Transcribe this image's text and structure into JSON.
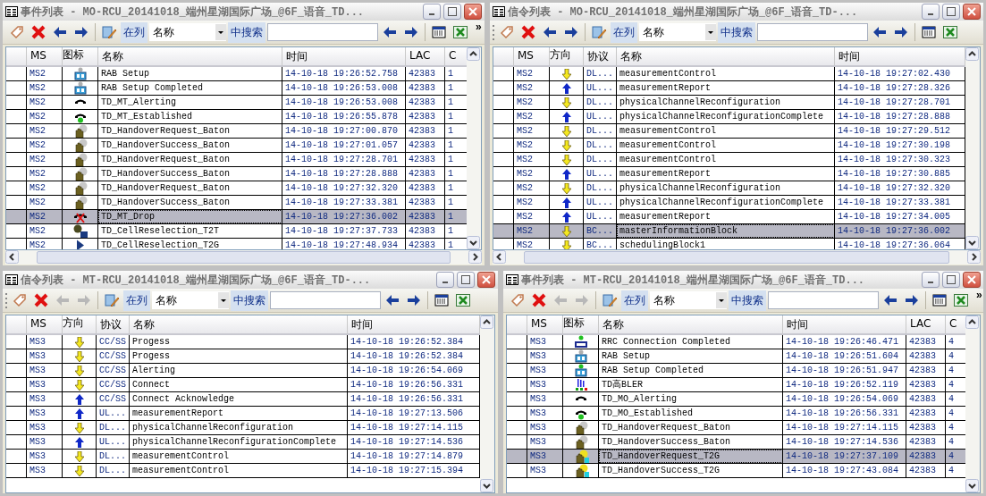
{
  "windows": [
    {
      "title": "事件列表 - MO-RCU_20141018_端州星湖国际广场_@6F_语音_TD...",
      "nav_enabled": true,
      "toolbar": {
        "in_column": "在列",
        "column": "名称",
        "search_label": "中搜索",
        "overflow": "»"
      },
      "columns": [
        {
          "kind": "ms",
          "label": "MS"
        },
        {
          "kind": "icon",
          "label": "图标"
        },
        {
          "kind": "name",
          "label": "名称"
        },
        {
          "kind": "time",
          "label": "时间"
        },
        {
          "kind": "lac",
          "label": "LAC"
        },
        {
          "kind": "cut",
          "label": "C"
        }
      ],
      "rows": [
        {
          "ms": "MS2",
          "kind": "rb-gray",
          "name": "RAB Setup",
          "time": "14-10-18 19:26:52.758",
          "lac": "42383",
          "cut": "1",
          "selected": false
        },
        {
          "ms": "MS2",
          "kind": "rb-gray",
          "name": "RAB Setup Completed",
          "time": "14-10-18 19:26:53.008",
          "lac": "42383",
          "cut": "1",
          "selected": false
        },
        {
          "ms": "MS2",
          "kind": "phone",
          "name": "TD_MT_Alerting",
          "time": "14-10-18 19:26:53.008",
          "lac": "42383",
          "cut": "1",
          "selected": false
        },
        {
          "ms": "MS2",
          "kind": "phone-dot",
          "name": "TD_MT_Established",
          "time": "14-10-18 19:26:55.878",
          "lac": "42383",
          "cut": "1",
          "selected": false
        },
        {
          "ms": "MS2",
          "kind": "hand",
          "name": "TD_HandoverRequest_Baton",
          "time": "14-10-18 19:27:00.870",
          "lac": "42383",
          "cut": "1",
          "selected": false
        },
        {
          "ms": "MS2",
          "kind": "hand",
          "name": "TD_HandoverSuccess_Baton",
          "time": "14-10-18 19:27:01.057",
          "lac": "42383",
          "cut": "1",
          "selected": false
        },
        {
          "ms": "MS2",
          "kind": "hand",
          "name": "TD_HandoverRequest_Baton",
          "time": "14-10-18 19:27:28.701",
          "lac": "42383",
          "cut": "1",
          "selected": false
        },
        {
          "ms": "MS2",
          "kind": "hand",
          "name": "TD_HandoverSuccess_Baton",
          "time": "14-10-18 19:27:28.888",
          "lac": "42383",
          "cut": "1",
          "selected": false
        },
        {
          "ms": "MS2",
          "kind": "hand",
          "name": "TD_HandoverRequest_Baton",
          "time": "14-10-18 19:27:32.320",
          "lac": "42383",
          "cut": "1",
          "selected": false
        },
        {
          "ms": "MS2",
          "kind": "hand",
          "name": "TD_HandoverSuccess_Baton",
          "time": "14-10-18 19:27:33.381",
          "lac": "42383",
          "cut": "1",
          "selected": false
        },
        {
          "ms": "MS2",
          "kind": "drop",
          "name": "TD_MT_Drop",
          "time": "14-10-18 19:27:36.002",
          "lac": "42383",
          "cut": "1",
          "selected": true
        },
        {
          "ms": "MS2",
          "kind": "cells",
          "name": "TD_CellReselection_T2T",
          "time": "14-10-18 19:27:37.733",
          "lac": "42383",
          "cut": "1",
          "selected": false
        },
        {
          "ms": "MS2",
          "kind": "triangle",
          "name": "TD_CellReselection_T2G",
          "time": "14-10-18 19:27:48.934",
          "lac": "42383",
          "cut": "1",
          "selected": false
        }
      ]
    },
    {
      "title": "信令列表 - MO-RCU_20141018_端州星湖国际广场_@6F_语音_TD-...",
      "nav_enabled": true,
      "toolbar": {
        "in_column": "在列",
        "column": "名称",
        "search_label": "中搜索"
      },
      "columns": [
        {
          "kind": "ms",
          "label": "MS"
        },
        {
          "kind": "dir",
          "label": "方向"
        },
        {
          "kind": "proto",
          "label": "协议"
        },
        {
          "kind": "name",
          "label": "名称"
        },
        {
          "kind": "time",
          "label": "时间"
        }
      ],
      "rows": [
        {
          "ms": "MS2",
          "kind": "down",
          "proto": "DL...",
          "name": "measurementControl",
          "time": "14-10-18 19:27:02.430",
          "selected": false
        },
        {
          "ms": "MS2",
          "kind": "up",
          "proto": "UL...",
          "name": "measurementReport",
          "time": "14-10-18 19:27:28.326",
          "selected": false
        },
        {
          "ms": "MS2",
          "kind": "down",
          "proto": "DL...",
          "name": "physicalChannelReconfiguration",
          "time": "14-10-18 19:27:28.701",
          "selected": false
        },
        {
          "ms": "MS2",
          "kind": "up",
          "proto": "UL...",
          "name": "physicalChannelReconfigurationComplete",
          "time": "14-10-18 19:27:28.888",
          "selected": false
        },
        {
          "ms": "MS2",
          "kind": "down",
          "proto": "DL...",
          "name": "measurementControl",
          "time": "14-10-18 19:27:29.512",
          "selected": false
        },
        {
          "ms": "MS2",
          "kind": "down",
          "proto": "DL...",
          "name": "measurementControl",
          "time": "14-10-18 19:27:30.198",
          "selected": false
        },
        {
          "ms": "MS2",
          "kind": "down",
          "proto": "DL...",
          "name": "measurementControl",
          "time": "14-10-18 19:27:30.323",
          "selected": false
        },
        {
          "ms": "MS2",
          "kind": "up",
          "proto": "UL...",
          "name": "measurementReport",
          "time": "14-10-18 19:27:30.885",
          "selected": false
        },
        {
          "ms": "MS2",
          "kind": "down",
          "proto": "DL...",
          "name": "physicalChannelReconfiguration",
          "time": "14-10-18 19:27:32.320",
          "selected": false
        },
        {
          "ms": "MS2",
          "kind": "up",
          "proto": "UL...",
          "name": "physicalChannelReconfigurationComplete",
          "time": "14-10-18 19:27:33.381",
          "selected": false
        },
        {
          "ms": "MS2",
          "kind": "up",
          "proto": "UL...",
          "name": "measurementReport",
          "time": "14-10-18 19:27:34.005",
          "selected": false
        },
        {
          "ms": "MS2",
          "kind": "down",
          "proto": "BC...",
          "name": "masterInformationBlock",
          "time": "14-10-18 19:27:36.002",
          "selected": true
        },
        {
          "ms": "MS2",
          "kind": "down",
          "proto": "BC...",
          "name": "schedulingBlock1",
          "time": "14-10-18 19:27:36.064",
          "selected": false
        }
      ]
    },
    {
      "title": "信令列表 - MT-RCU_20141018_端州星湖国际广场_@6F_语音_TD-...",
      "nav_enabled": false,
      "toolbar": {
        "in_column": "在列",
        "column": "名称",
        "search_label": "中搜索"
      },
      "columns": [
        {
          "kind": "ms",
          "label": "MS"
        },
        {
          "kind": "dir",
          "label": "方向"
        },
        {
          "kind": "proto",
          "label": "协议"
        },
        {
          "kind": "name",
          "label": "名称"
        },
        {
          "kind": "time",
          "label": "时间"
        }
      ],
      "rows": [
        {
          "ms": "MS3",
          "kind": "down",
          "proto": "CC/SS",
          "name": "Progess",
          "time": "14-10-18 19:26:52.384",
          "selected": false
        },
        {
          "ms": "MS3",
          "kind": "down",
          "proto": "CC/SS",
          "name": "Progess",
          "time": "14-10-18 19:26:52.384",
          "selected": false
        },
        {
          "ms": "MS3",
          "kind": "down",
          "proto": "CC/SS",
          "name": "Alerting",
          "time": "14-10-18 19:26:54.069",
          "selected": false
        },
        {
          "ms": "MS3",
          "kind": "down",
          "proto": "CC/SS",
          "name": "Connect",
          "time": "14-10-18 19:26:56.331",
          "selected": false
        },
        {
          "ms": "MS3",
          "kind": "up",
          "proto": "CC/SS",
          "name": "Connect Acknowledge",
          "time": "14-10-18 19:26:56.331",
          "selected": false
        },
        {
          "ms": "MS3",
          "kind": "up",
          "proto": "UL...",
          "name": "measurementReport",
          "time": "14-10-18 19:27:13.506",
          "selected": false
        },
        {
          "ms": "MS3",
          "kind": "down",
          "proto": "DL...",
          "name": "physicalChannelReconfiguration",
          "time": "14-10-18 19:27:14.115",
          "selected": false
        },
        {
          "ms": "MS3",
          "kind": "up",
          "proto": "UL...",
          "name": "physicalChannelReconfigurationComplete",
          "time": "14-10-18 19:27:14.536",
          "selected": false
        },
        {
          "ms": "MS3",
          "kind": "down",
          "proto": "DL...",
          "name": "measurementControl",
          "time": "14-10-18 19:27:14.879",
          "selected": false
        },
        {
          "ms": "MS3",
          "kind": "down",
          "proto": "DL...",
          "name": "measurementControl",
          "time": "14-10-18 19:27:15.394",
          "selected": false
        }
      ]
    },
    {
      "title": "事件列表 - MT-RCU_20141018_端州星湖国际广场_@6F_语音_TD...",
      "nav_enabled": false,
      "toolbar": {
        "in_column": "在列",
        "column": "名称",
        "search_label": "中搜索",
        "overflow": "»"
      },
      "columns": [
        {
          "kind": "ms",
          "label": "MS"
        },
        {
          "kind": "icon",
          "label": "图标"
        },
        {
          "kind": "name",
          "label": "名称"
        },
        {
          "kind": "time",
          "label": "时间"
        },
        {
          "kind": "lac",
          "label": "LAC"
        },
        {
          "kind": "cut",
          "label": "C"
        }
      ],
      "rows": [
        {
          "ms": "MS3",
          "kind": "rrc",
          "name": "RRC Connection Completed",
          "time": "14-10-18 19:26:46.471",
          "lac": "42383",
          "cut": "4",
          "selected": false
        },
        {
          "ms": "MS3",
          "kind": "rb-gray",
          "name": "RAB Setup",
          "time": "14-10-18 19:26:51.604",
          "lac": "42383",
          "cut": "4",
          "selected": false
        },
        {
          "ms": "MS3",
          "kind": "rb-green",
          "name": "RAB Setup Completed",
          "time": "14-10-18 19:26:51.947",
          "lac": "42383",
          "cut": "4",
          "selected": false
        },
        {
          "ms": "MS3",
          "kind": "bler",
          "name": "TD高BLER",
          "time": "14-10-18 19:26:52.119",
          "lac": "42383",
          "cut": "4",
          "selected": false
        },
        {
          "ms": "MS3",
          "kind": "phone",
          "name": "TD_MO_Alerting",
          "time": "14-10-18 19:26:54.069",
          "lac": "42383",
          "cut": "4",
          "selected": false
        },
        {
          "ms": "MS3",
          "kind": "phone-dot",
          "name": "TD_MO_Established",
          "time": "14-10-18 19:26:56.331",
          "lac": "42383",
          "cut": "4",
          "selected": false
        },
        {
          "ms": "MS3",
          "kind": "hand",
          "name": "TD_HandoverRequest_Baton",
          "time": "14-10-18 19:27:14.115",
          "lac": "42383",
          "cut": "4",
          "selected": false
        },
        {
          "ms": "MS3",
          "kind": "hand",
          "name": "TD_HandoverSuccess_Baton",
          "time": "14-10-18 19:27:14.536",
          "lac": "42383",
          "cut": "4",
          "selected": false
        },
        {
          "ms": "MS3",
          "kind": "hand-t2g",
          "name": "TD_HandoverRequest_T2G",
          "time": "14-10-18 19:27:37.109",
          "lac": "42383",
          "cut": "4",
          "selected": true
        },
        {
          "ms": "MS3",
          "kind": "hand-t2g",
          "name": "TD_HandoverSuccess_T2G",
          "time": "14-10-18 19:27:43.084",
          "lac": "42383",
          "cut": "4",
          "selected": false
        }
      ]
    }
  ]
}
